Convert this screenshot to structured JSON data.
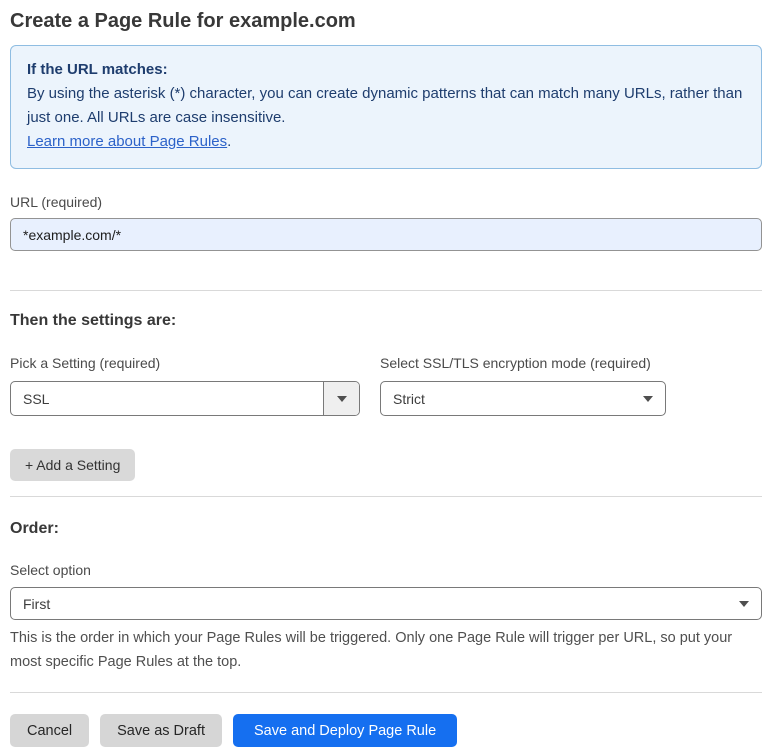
{
  "page": {
    "title": "Create a Page Rule for example.com"
  },
  "info_box": {
    "heading": "If the URL matches:",
    "body": "By using the asterisk (*) character, you can create dynamic patterns that can match many URLs, rather than just one. All URLs are case insensitive.",
    "link": "Learn more about Page Rules",
    "link_suffix": "."
  },
  "url_field": {
    "label": "URL (required)",
    "value": "*example.com/*"
  },
  "settings_section": {
    "heading": "Then the settings are:",
    "setting_select": {
      "label": "Pick a Setting (required)",
      "value": "SSL"
    },
    "mode_select": {
      "label": "Select SSL/TLS encryption mode (required)",
      "value": "Strict"
    },
    "add_setting_label": "+ Add a Setting"
  },
  "order_section": {
    "heading": "Order:",
    "select_label": "Select option",
    "select_value": "First",
    "help_text": "This is the order in which your Page Rules will be triggered. Only one Page Rule will trigger per URL, so put your most specific Page Rules at the top."
  },
  "footer": {
    "cancel_label": "Cancel",
    "save_draft_label": "Save as Draft",
    "save_deploy_label": "Save and Deploy Page Rule"
  },
  "colors": {
    "accent_blue": "#156ff0",
    "info_background": "#ecf4fc",
    "info_border": "#8fbde2",
    "info_text": "#1e3d6e",
    "link_blue": "#2c62c9",
    "url_input_background": "#e8f0fe"
  }
}
